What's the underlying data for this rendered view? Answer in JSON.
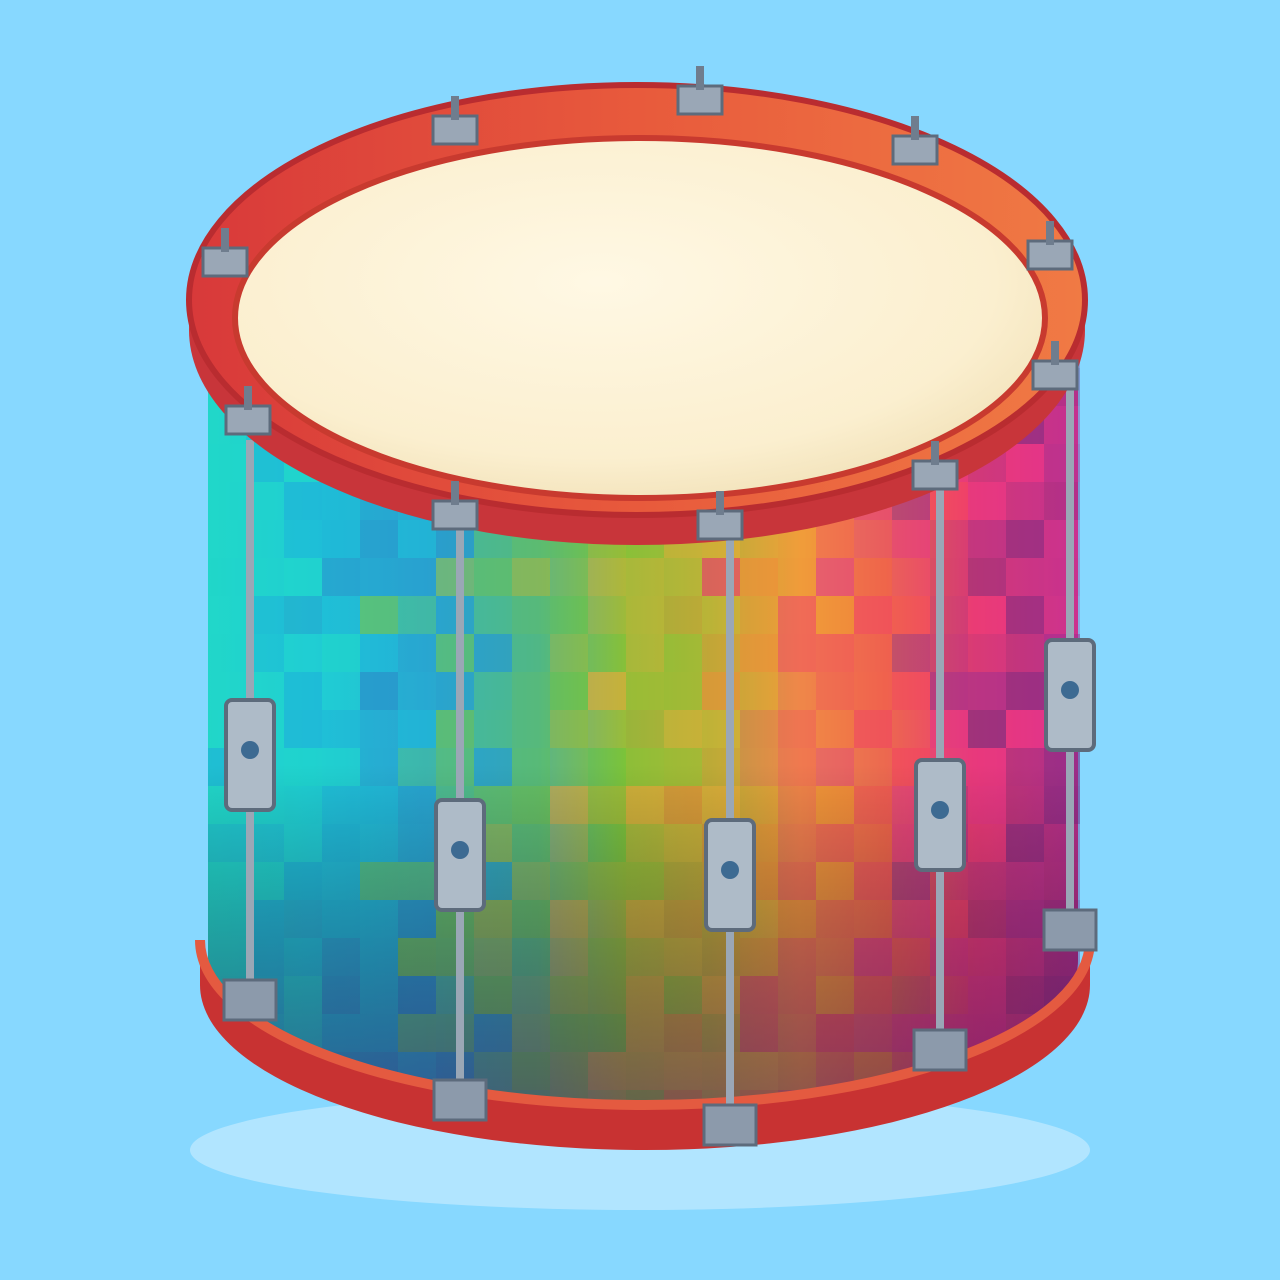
{
  "background_color": "#87d8ff",
  "drum": {
    "icon": "drum-icon",
    "shell_gradient_colors": [
      "#21d7c9",
      "#1fb3d6",
      "#2a8fc9",
      "#7cc33a",
      "#a7b936",
      "#f0a73a",
      "#f08a3a",
      "#ef3f6b",
      "#e0338f",
      "#9a2e91",
      "#6d2a84"
    ],
    "hoop_color": "#e0453c",
    "hoop_highlight_color": "#f06f44",
    "head_color": "#fbefcf",
    "hardware_color": "#9aa7b6"
  }
}
